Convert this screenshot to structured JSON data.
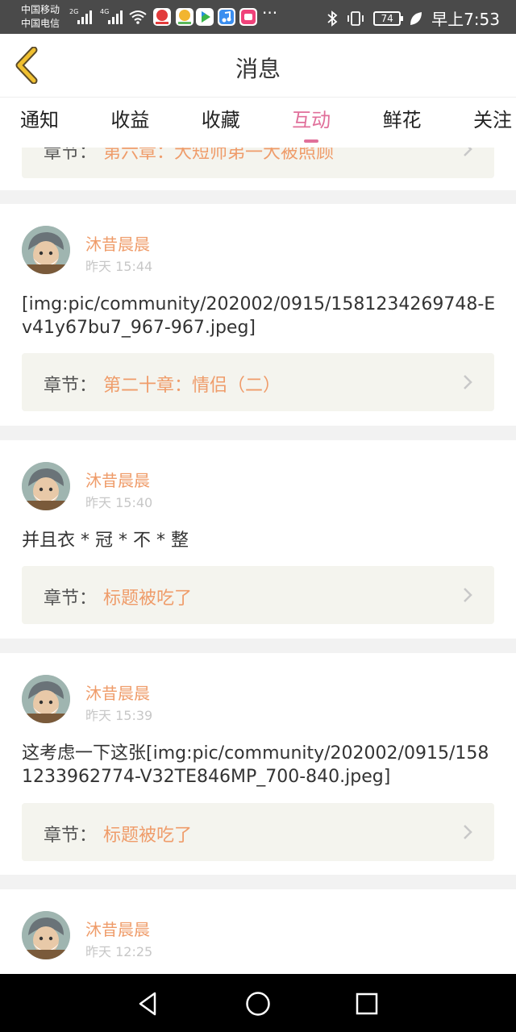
{
  "status_bar": {
    "carrier_1": "中国移动",
    "carrier_2": "中国电信",
    "net_1": "2G",
    "net_2": "4G",
    "dots": "···",
    "battery": "74",
    "time": "早上7:53"
  },
  "header": {
    "title": "消息"
  },
  "tabs": [
    {
      "label": "通知"
    },
    {
      "label": "收益"
    },
    {
      "label": "收藏"
    },
    {
      "label": "互动",
      "active": true
    },
    {
      "label": "鲜花"
    },
    {
      "label": "关注"
    }
  ],
  "partial_card": {
    "chapter_label": "章节：",
    "chapter_value": "第六章：大短师弟一大被照顾"
  },
  "cards": [
    {
      "username": "沐昔晨晨",
      "time": "昨天 15:44",
      "content": "[img:pic/community/202002/0915/1581234269748-Ev41y67bu7_967-967.jpeg]",
      "chapter_label": "章节：",
      "chapter_value": "第二十章：情侣（二）"
    },
    {
      "username": "沐昔晨晨",
      "time": "昨天 15:40",
      "content": "并且衣 * 冠 * 不 * 整",
      "chapter_label": "章节：",
      "chapter_value": "标题被吃了"
    },
    {
      "username": "沐昔晨晨",
      "time": "昨天 15:39",
      "content": "这考虑一下这张[img:pic/community/202002/0915/1581233962774-V32TE846MP_700-840.jpeg]",
      "chapter_label": "章节：",
      "chapter_value": "标题被吃了"
    },
    {
      "username": "沐昔晨晨",
      "time": "昨天 12:25"
    }
  ],
  "colors": {
    "accent_pink": "#e06f9a",
    "username_orange": "#ef9c6a",
    "back_icon": "#f0c030"
  }
}
